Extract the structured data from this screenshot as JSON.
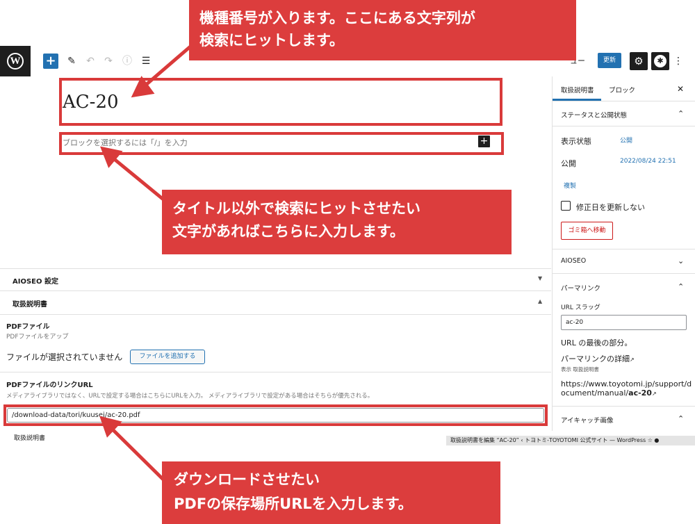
{
  "toolbar": {
    "logo_glyph": "W",
    "add_glyph": "+",
    "edit_glyph": "✎",
    "undo_glyph": "↶",
    "redo_glyph": "↷",
    "info_glyph": "ⓘ",
    "list_glyph": "☰",
    "preview_partial": "ュー",
    "update_label": "更新",
    "settings_glyph": "⚙",
    "aioseo_glyph": "✱",
    "more_glyph": "⋮"
  },
  "editor": {
    "post_title": "AC-20",
    "block_placeholder": "ブロックを選択するには「/」を入力",
    "add_glyph": "+"
  },
  "meta": {
    "aioseo_title": "AIOSEO 設定",
    "aioseo_arrow": "▼",
    "manual_title": "取扱説明書",
    "manual_arrow": "▲",
    "pdf_file_label": "PDFファイル",
    "pdf_file_desc": "PDFファイルをアップ",
    "no_file_text": "ファイルが選択されていません",
    "add_file_button": "ファイルを追加する",
    "pdf_link_label": "PDFファイルのリンクURL",
    "pdf_link_desc": "メディアライブラリではなく、URLで設定する場合はこちらにURLを入力。 メディアライブラリで設定がある場合はそちらが優先される。",
    "pdf_url_value": "/download-data/tori/kuusei/ac-20.pdf",
    "footer_breadcrumb": "取扱説明書",
    "browser_status": "取扱説明書を編集 “AC-20” ‹ トヨトミ-TOYOTOMI 公式サイト — WordPress ☆ ●"
  },
  "sidebar": {
    "tab_document": "取扱説明書",
    "tab_block": "ブロック",
    "close_glyph": "✕",
    "status_title": "ステータスと公開状態",
    "up_glyph": "⌃",
    "down_glyph": "⌄",
    "visibility_label": "表示状態",
    "visibility_value": "公開",
    "publish_label": "公開",
    "publish_value": "2022/08/24 22:51",
    "duplicate_link": "複製",
    "modified_label": "修正日を更新しない",
    "trash_button": "ゴミ箱へ移動",
    "aioseo_panel_title": "AIOSEO",
    "permalink_title": "パーマリンク",
    "slug_label": "URL スラッグ",
    "slug_value": "ac-20",
    "slug_hint": "URL の最後の部分。",
    "permalink_detail": "パーマリンクの詳細",
    "external_glyph": "↗",
    "permalink_sub": "表示 取扱説明書",
    "permalink_url_prefix": "https://www.toyotomi.jp/support/document/manual/",
    "permalink_url_slug": "ac-20",
    "featured_title": "アイキャッチ画像"
  },
  "callouts": {
    "top_line1": "機種番号が入ります。ここにある文字列が",
    "top_line2": "検索にヒットします。",
    "middle_line1": "タイトル以外で検索にヒットさせたい",
    "middle_line2": "文字があればこちらに入力します。",
    "bottom_line1": "ダウンロードさせたい",
    "bottom_line2": "PDFの保存場所URLを入力します。"
  },
  "colors": {
    "callout_red": "#dc3d3d",
    "highlight_red": "#d93a3a",
    "wp_blue": "#2271b1",
    "danger_red": "#cc1818"
  }
}
